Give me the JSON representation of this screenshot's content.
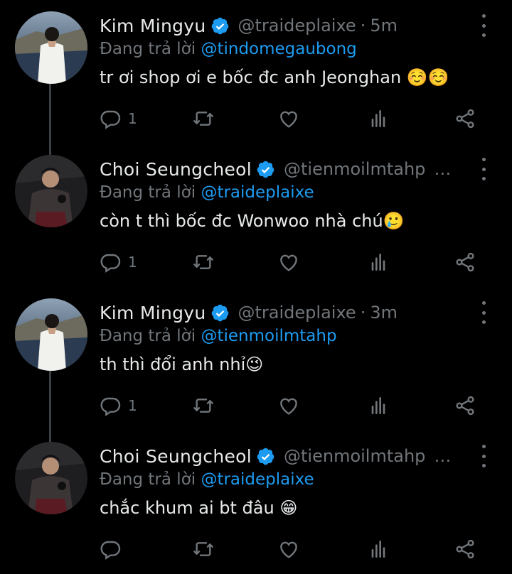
{
  "tweets": [
    {
      "name": "Kim Mingyu",
      "handle": "@traideplaixe",
      "dot": "·",
      "time": "5m",
      "reply_prefix": "Đang trả lời",
      "reply_to": "@tindomegaubong",
      "text": "tr ơi shop ơi e bốc đc anh Jeonghan ☺️☺️",
      "reply_count": "1",
      "avatar": "avatar-mingyu"
    },
    {
      "name": "Choi Seungcheol",
      "handle": "@tienmoilmtahp",
      "dot": "",
      "time": "…",
      "reply_prefix": "Đang trả lời",
      "reply_to": "@traideplaixe",
      "text": "còn t thì bốc đc Wonwoo nhà chú🥲",
      "reply_count": "1",
      "avatar": "avatar-seungcheol"
    },
    {
      "name": "Kim Mingyu",
      "handle": "@traideplaixe",
      "dot": "·",
      "time": "3m",
      "reply_prefix": "Đang trả lời",
      "reply_to": "@tienmoilmtahp",
      "text": "th thì đổi anh nhỉ😉",
      "reply_count": "1",
      "avatar": "avatar-mingyu"
    },
    {
      "name": "Choi Seungcheol",
      "handle": "@tienmoilmtahp",
      "dot": "",
      "time": "…",
      "reply_prefix": "Đang trả lời",
      "reply_to": "@traideplaixe",
      "text": "chắc khum ai bt đâu 😁",
      "reply_count": "",
      "avatar": "avatar-seungcheol"
    }
  ],
  "colors": {
    "background": "#000000",
    "text": "#e7e9ea",
    "muted": "#71767b",
    "accent": "#1d9bf0",
    "thread_line": "#3a3f44"
  },
  "icons": [
    "verified-badge-icon",
    "more-options-icon",
    "reply-icon",
    "retweet-icon",
    "like-icon",
    "analytics-icon",
    "share-icon"
  ]
}
